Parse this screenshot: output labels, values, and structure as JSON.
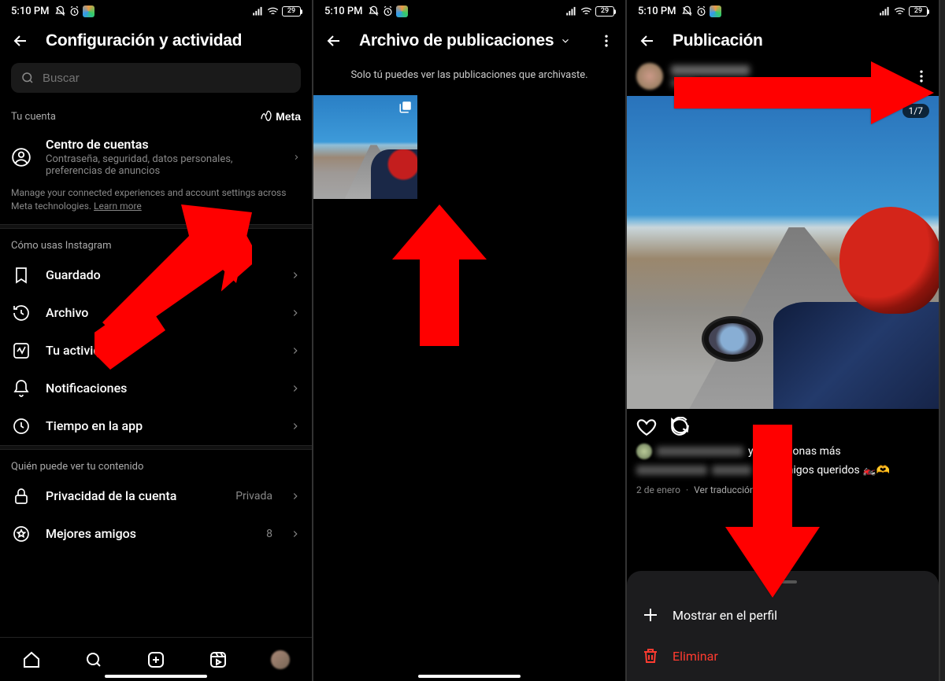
{
  "status": {
    "time": "5:10 PM",
    "battery": "29"
  },
  "screen1": {
    "title": "Configuración y actividad",
    "search_placeholder": "Buscar",
    "account_label": "Tu cuenta",
    "meta_label": "Meta",
    "account_center": {
      "title": "Centro de cuentas",
      "subtitle": "Contraseña, seguridad, datos personales, preferencias de anuncios"
    },
    "manage_desc": "Manage your connected experiences and account settings across Meta technologies. ",
    "learn_more": "Learn more",
    "usage_section": "Cómo usas Instagram",
    "items": {
      "saved": "Guardado",
      "archive": "Archivo",
      "activity": "Tu actividad",
      "notifications": "Notificaciones",
      "time": "Tiempo en la app"
    },
    "visibility_section": "Quién puede ver tu contenido",
    "privacy": {
      "label": "Privacidad de la cuenta",
      "value": "Privada"
    },
    "close_friends": {
      "label": "Mejores amigos",
      "value": "8"
    }
  },
  "screen2": {
    "title": "Archivo de publicaciones",
    "banner": "Solo tú puedes ver las publicaciones que archivaste."
  },
  "screen3": {
    "title": "Publicación",
    "counter": "1/7",
    "likes_text": "y 32 personas más",
    "caption_tail": "con amigos queridos 🏍️🫶",
    "date": "2 de enero",
    "see_translation": "Ver traducción",
    "sheet": {
      "show_profile": "Mostrar en el perfil",
      "delete": "Eliminar"
    }
  }
}
